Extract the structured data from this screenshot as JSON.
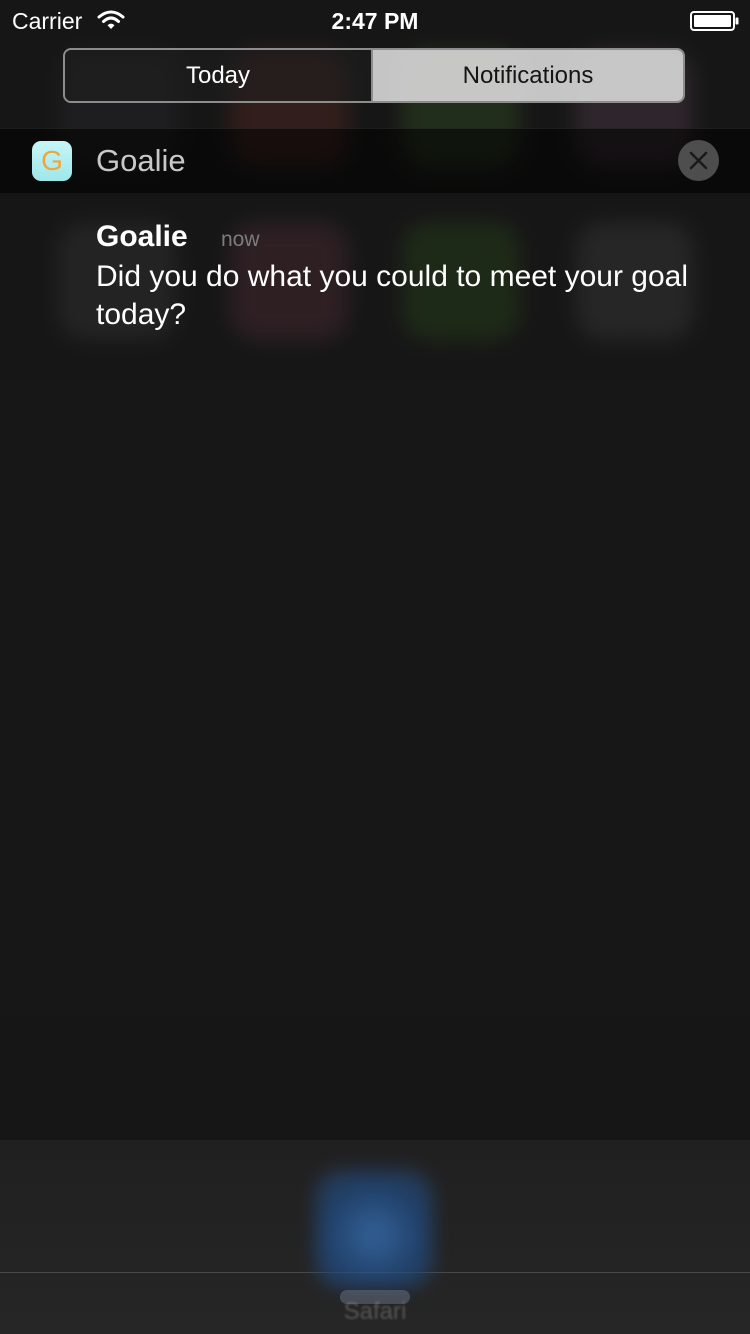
{
  "status_bar": {
    "carrier": "Carrier",
    "time": "2:47 PM"
  },
  "segmented_control": {
    "tabs": [
      {
        "label": "Today",
        "selected": false
      },
      {
        "label": "Notifications",
        "selected": true
      }
    ]
  },
  "notification_group": {
    "app_name": "Goalie",
    "app_icon_glyph": "G",
    "clear_icon": "close-icon",
    "items": [
      {
        "title": "Goalie",
        "time": "now",
        "message": "Did you do what you could to meet your goal today?"
      }
    ]
  },
  "dock": {
    "app_label": "Safari"
  },
  "colors": {
    "background": "#1a1a1a",
    "selected_tab_bg": "#dedede",
    "app_icon_bg": "#b4f0f2",
    "app_icon_glyph": "#f0a53c"
  }
}
